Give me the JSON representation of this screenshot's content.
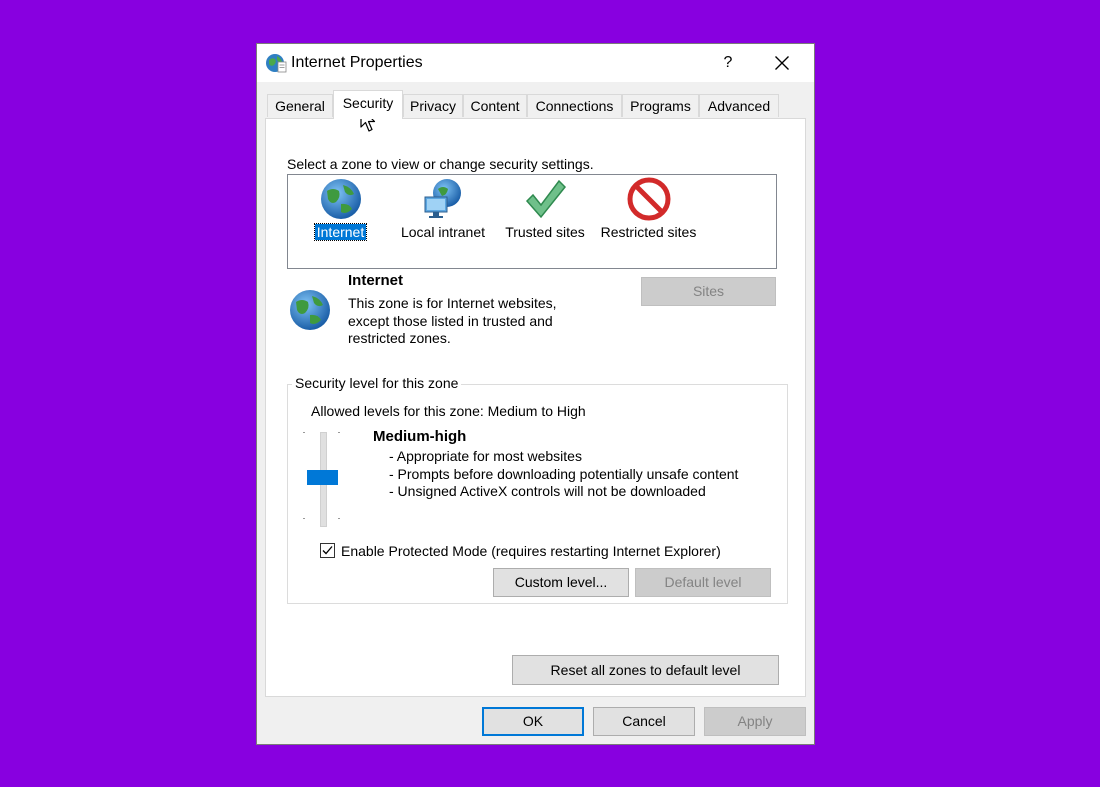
{
  "window": {
    "title": "Internet Properties",
    "help_glyph": "?",
    "close_glyph": "✕"
  },
  "tabs": [
    {
      "label": "General"
    },
    {
      "label": "Security",
      "active": true
    },
    {
      "label": "Privacy"
    },
    {
      "label": "Content"
    },
    {
      "label": "Connections"
    },
    {
      "label": "Programs"
    },
    {
      "label": "Advanced"
    }
  ],
  "security": {
    "zone_prompt": "Select a zone to view or change security settings.",
    "zones": [
      {
        "label": "Internet",
        "icon": "globe-icon",
        "selected": true
      },
      {
        "label": "Local intranet",
        "icon": "intranet-icon"
      },
      {
        "label": "Trusted sites",
        "icon": "checkmark-icon"
      },
      {
        "label": "Restricted sites",
        "icon": "restricted-icon"
      }
    ],
    "zone_name": "Internet",
    "zone_description": [
      "This zone is for Internet websites,",
      "except those listed in trusted and",
      "restricted zones."
    ],
    "sites_button": "Sites",
    "level_group_label": "Security level for this zone",
    "allowed_levels": "Allowed levels for this zone: Medium to High",
    "level_name": "Medium-high",
    "level_points": [
      "- Appropriate for most websites",
      "- Prompts before downloading potentially unsafe content",
      "- Unsigned ActiveX controls will not be downloaded"
    ],
    "slider_level": "Medium-high",
    "protected_mode_label": "Enable Protected Mode (requires restarting Internet Explorer)",
    "protected_mode_checked": true,
    "custom_level_button": "Custom level...",
    "default_level_button": "Default level",
    "reset_all_button": "Reset all zones to default level"
  },
  "footer": {
    "ok": "OK",
    "cancel": "Cancel",
    "apply": "Apply"
  },
  "colors": {
    "background": "#8800e0",
    "selection": "#0078d7",
    "slider_thumb": "#0078d7"
  }
}
